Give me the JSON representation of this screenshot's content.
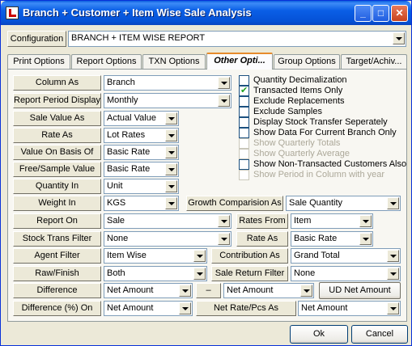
{
  "window": {
    "title": "Branch + Customer + Item Wise Sale Analysis"
  },
  "config": {
    "label": "Configuration",
    "value": "BRANCH + ITEM WISE REPORT"
  },
  "tabs": [
    {
      "label": "Print Options"
    },
    {
      "label": "Report Options"
    },
    {
      "label": "TXN Options"
    },
    {
      "label": "Other Opti..."
    },
    {
      "label": "Group Options"
    },
    {
      "label": "Target/Achiv..."
    }
  ],
  "fields": {
    "column_as": {
      "label": "Column As",
      "value": "Branch"
    },
    "report_period": {
      "label": "Report Period Display",
      "value": "Monthly"
    },
    "sale_value_as": {
      "label": "Sale Value As",
      "value": "Actual Value"
    },
    "rate_as": {
      "label": "Rate As",
      "value": "Lot Rates"
    },
    "value_basis": {
      "label": "Value On Basis Of",
      "value": "Basic Rate"
    },
    "free_sample": {
      "label": "Free/Sample Value",
      "value": "Basic Rate"
    },
    "quantity_in": {
      "label": "Quantity In",
      "value": "Unit"
    },
    "weight_in": {
      "label": "Weight In",
      "value": "KGS"
    },
    "growth_as": {
      "label": "Growth Comparision As",
      "value": "Sale Quantity"
    },
    "report_on": {
      "label": "Report On",
      "value": "Sale"
    },
    "rates_from": {
      "label": "Rates From",
      "value": "Item"
    },
    "stock_trans": {
      "label": "Stock Trans Filter",
      "value": "None"
    },
    "rate_as2": {
      "label": "Rate As",
      "value": "Basic Rate"
    },
    "agent_filter": {
      "label": "Agent Filter",
      "value": "Item Wise"
    },
    "contribution_as": {
      "label": "Contribution As",
      "value": "Grand Total"
    },
    "raw_finish": {
      "label": "Raw/Finish",
      "value": "Both"
    },
    "sale_return": {
      "label": "Sale Return Filter",
      "value": "None"
    },
    "difference": {
      "label": "Difference",
      "value1": "Net Amount",
      "dash": "–",
      "value2": "Net Amount",
      "ud_button": "UD Net Amount"
    },
    "difference_pct": {
      "label": "Difference (%)  On",
      "value": "Net Amount"
    },
    "net_rate": {
      "label": "Net Rate/Pcs As",
      "value": "Net Amount"
    }
  },
  "checkboxes": [
    {
      "label": "Quantity Decimalization",
      "checked": false,
      "disabled": false
    },
    {
      "label": "Transacted Items Only",
      "checked": true,
      "disabled": false
    },
    {
      "label": "Exclude Replacements",
      "checked": false,
      "disabled": false
    },
    {
      "label": "Exclude Samples",
      "checked": false,
      "disabled": false
    },
    {
      "label": "Display Stock Transfer Seperately",
      "checked": false,
      "disabled": false
    },
    {
      "label": "Show Data For Current Branch Only",
      "checked": false,
      "disabled": false
    },
    {
      "label": "Show Quarterly Totals",
      "checked": false,
      "disabled": true
    },
    {
      "label": "Show Quarterly Average",
      "checked": false,
      "disabled": true
    },
    {
      "label": "Show Non-Transacted Customers Also",
      "checked": false,
      "disabled": false
    },
    {
      "label": "Show Period in Column with year",
      "checked": false,
      "disabled": true
    }
  ],
  "buttons": {
    "ok": "Ok",
    "cancel": "Cancel"
  }
}
